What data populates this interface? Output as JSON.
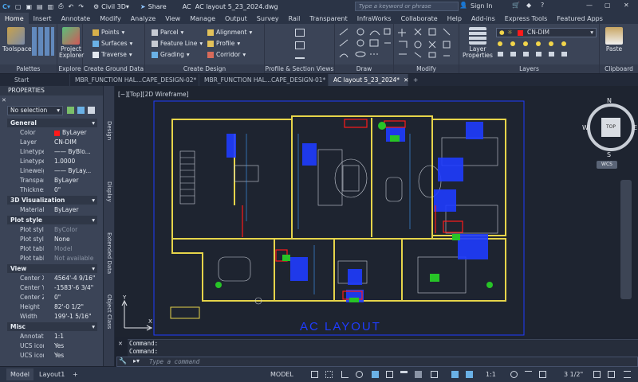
{
  "titlebar": {
    "workspace": "Civil 3D",
    "share": "Share",
    "doc_title": "AC layout 5_23_2024.dwg",
    "search_placeholder": "Type a keyword or phrase",
    "signin": "Sign In"
  },
  "ribbon_tabs": [
    "Home",
    "Insert",
    "Annotate",
    "Modify",
    "Analyze",
    "View",
    "Manage",
    "Output",
    "Survey",
    "Rail",
    "Transparent",
    "InfraWorks",
    "Collaborate",
    "Help",
    "Add-ins",
    "Express Tools",
    "Featured Apps"
  ],
  "ribbon": {
    "toolspace": "Toolspace",
    "project_explorer": [
      "Project",
      "Explorer"
    ],
    "points": "Points",
    "surfaces": "Surfaces",
    "traverse": "Traverse",
    "parcel": "Parcel",
    "feature_line": "Feature Line",
    "grading": "Grading",
    "alignment": "Alignment",
    "profile": "Profile",
    "corridor": "Corridor",
    "layer_properties": [
      "Layer",
      "Properties"
    ],
    "layer_name": "CN-DIM",
    "paste": "Paste",
    "panels": [
      "Palettes",
      "Explore",
      "Create Ground Data",
      "Create Design",
      "Profile & Section Views",
      "Draw",
      "Modify",
      "Layers",
      "Clipboard"
    ]
  },
  "file_tabs": [
    "Start",
    "MBR_FUNCTION HAL...CAPE_DESIGN-02*",
    "MBR_FUNCTION HAL...CAPE_DESIGN-01*",
    "AC layout 5_23_2024*"
  ],
  "properties": {
    "title": "PROPERTIES",
    "selection": "No selection",
    "general": {
      "header": "General",
      "rows": [
        {
          "k": "Color",
          "v": "ByLayer"
        },
        {
          "k": "Layer",
          "v": "CN-DIM"
        },
        {
          "k": "Linetype",
          "v": "—— ByBlo..."
        },
        {
          "k": "Linetype...",
          "v": "1.0000"
        },
        {
          "k": "Lineweight",
          "v": "—— ByLay..."
        },
        {
          "k": "Transpare...",
          "v": "ByLayer"
        },
        {
          "k": "Thickness",
          "v": "0\""
        }
      ]
    },
    "visualization": {
      "header": "3D Visualization",
      "rows": [
        {
          "k": "Material",
          "v": "ByLayer"
        }
      ]
    },
    "plot_style": {
      "header": "Plot style",
      "rows": [
        {
          "k": "Plot style",
          "v": "ByColor"
        },
        {
          "k": "Plot style...",
          "v": "None"
        },
        {
          "k": "Plot table...",
          "v": "Model"
        },
        {
          "k": "Plot table...",
          "v": "Not available"
        }
      ]
    },
    "view": {
      "header": "View",
      "rows": [
        {
          "k": "Center X",
          "v": "4564'-4 9/16\""
        },
        {
          "k": "Center Y",
          "v": "-1583'-6 3/4\""
        },
        {
          "k": "Center Z",
          "v": "0\""
        },
        {
          "k": "Height",
          "v": "82'-0 1/2\""
        },
        {
          "k": "Width",
          "v": "199'-1 5/16\""
        }
      ]
    },
    "misc": {
      "header": "Misc",
      "rows": [
        {
          "k": "Annotatio...",
          "v": "1:1"
        },
        {
          "k": "UCS icon...",
          "v": "Yes"
        },
        {
          "k": "UCS icon...",
          "v": "Yes"
        }
      ]
    },
    "side_tabs": [
      "Design",
      "Display",
      "Extended Data",
      "Object Class"
    ]
  },
  "viewport": {
    "label": "[−][Top][2D Wireframe]",
    "drawing_title": "AC LAYOUT",
    "viewcube": {
      "top": "TOP",
      "n": "N",
      "s": "S",
      "e": "E",
      "w": "W",
      "wcs": "WCS"
    },
    "ucs_x": "X",
    "ucs_y": "Y"
  },
  "command": {
    "history": [
      "Command:",
      "Command:"
    ],
    "placeholder": "Type a command"
  },
  "status": {
    "tabs": [
      "Model",
      "Layout1"
    ],
    "model": "MODEL",
    "scale": "1:1",
    "units": "3 1/2\""
  },
  "colors": {
    "accent": "#0696d7",
    "drawing_blue": "#1f3cff",
    "walls_yellow": "#e6d44a",
    "red": "#ff1a1a",
    "green": "#27c427"
  }
}
